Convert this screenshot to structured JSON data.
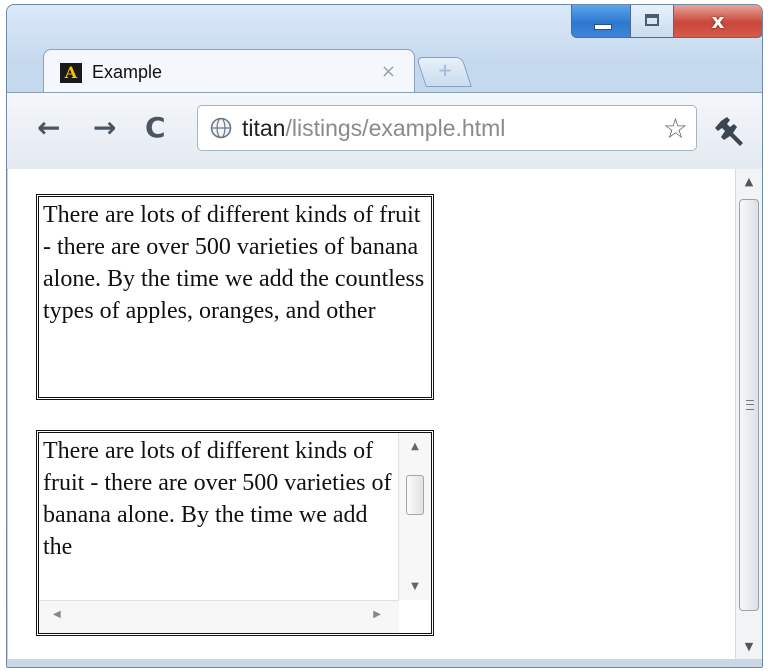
{
  "window": {
    "close_glyph": "x"
  },
  "tab": {
    "favicon_letter": "A",
    "title": "Example",
    "close_glyph": "×",
    "new_tab_glyph": "+"
  },
  "toolbar": {
    "back_glyph": "←",
    "forward_glyph": "→",
    "reload_glyph": "C",
    "url_host": "titan",
    "url_path": "/listings/example.html",
    "star_glyph": "☆"
  },
  "content": {
    "box1_text": "There are lots of different kinds of fruit - there are over 500 varieties of banana alone. By the time we add the countless types of apples, oranges, and other",
    "box2_text": "There are lots of different kinds of fruit - there are over 500 varieties of banana alone. By the time we add the"
  },
  "icons": {
    "page_scroll_up": "▲",
    "page_scroll_down": "▼",
    "box_scroll_up": "▲",
    "box_scroll_down": "▼",
    "box_scroll_left": "◀",
    "box_scroll_right": "▶"
  }
}
